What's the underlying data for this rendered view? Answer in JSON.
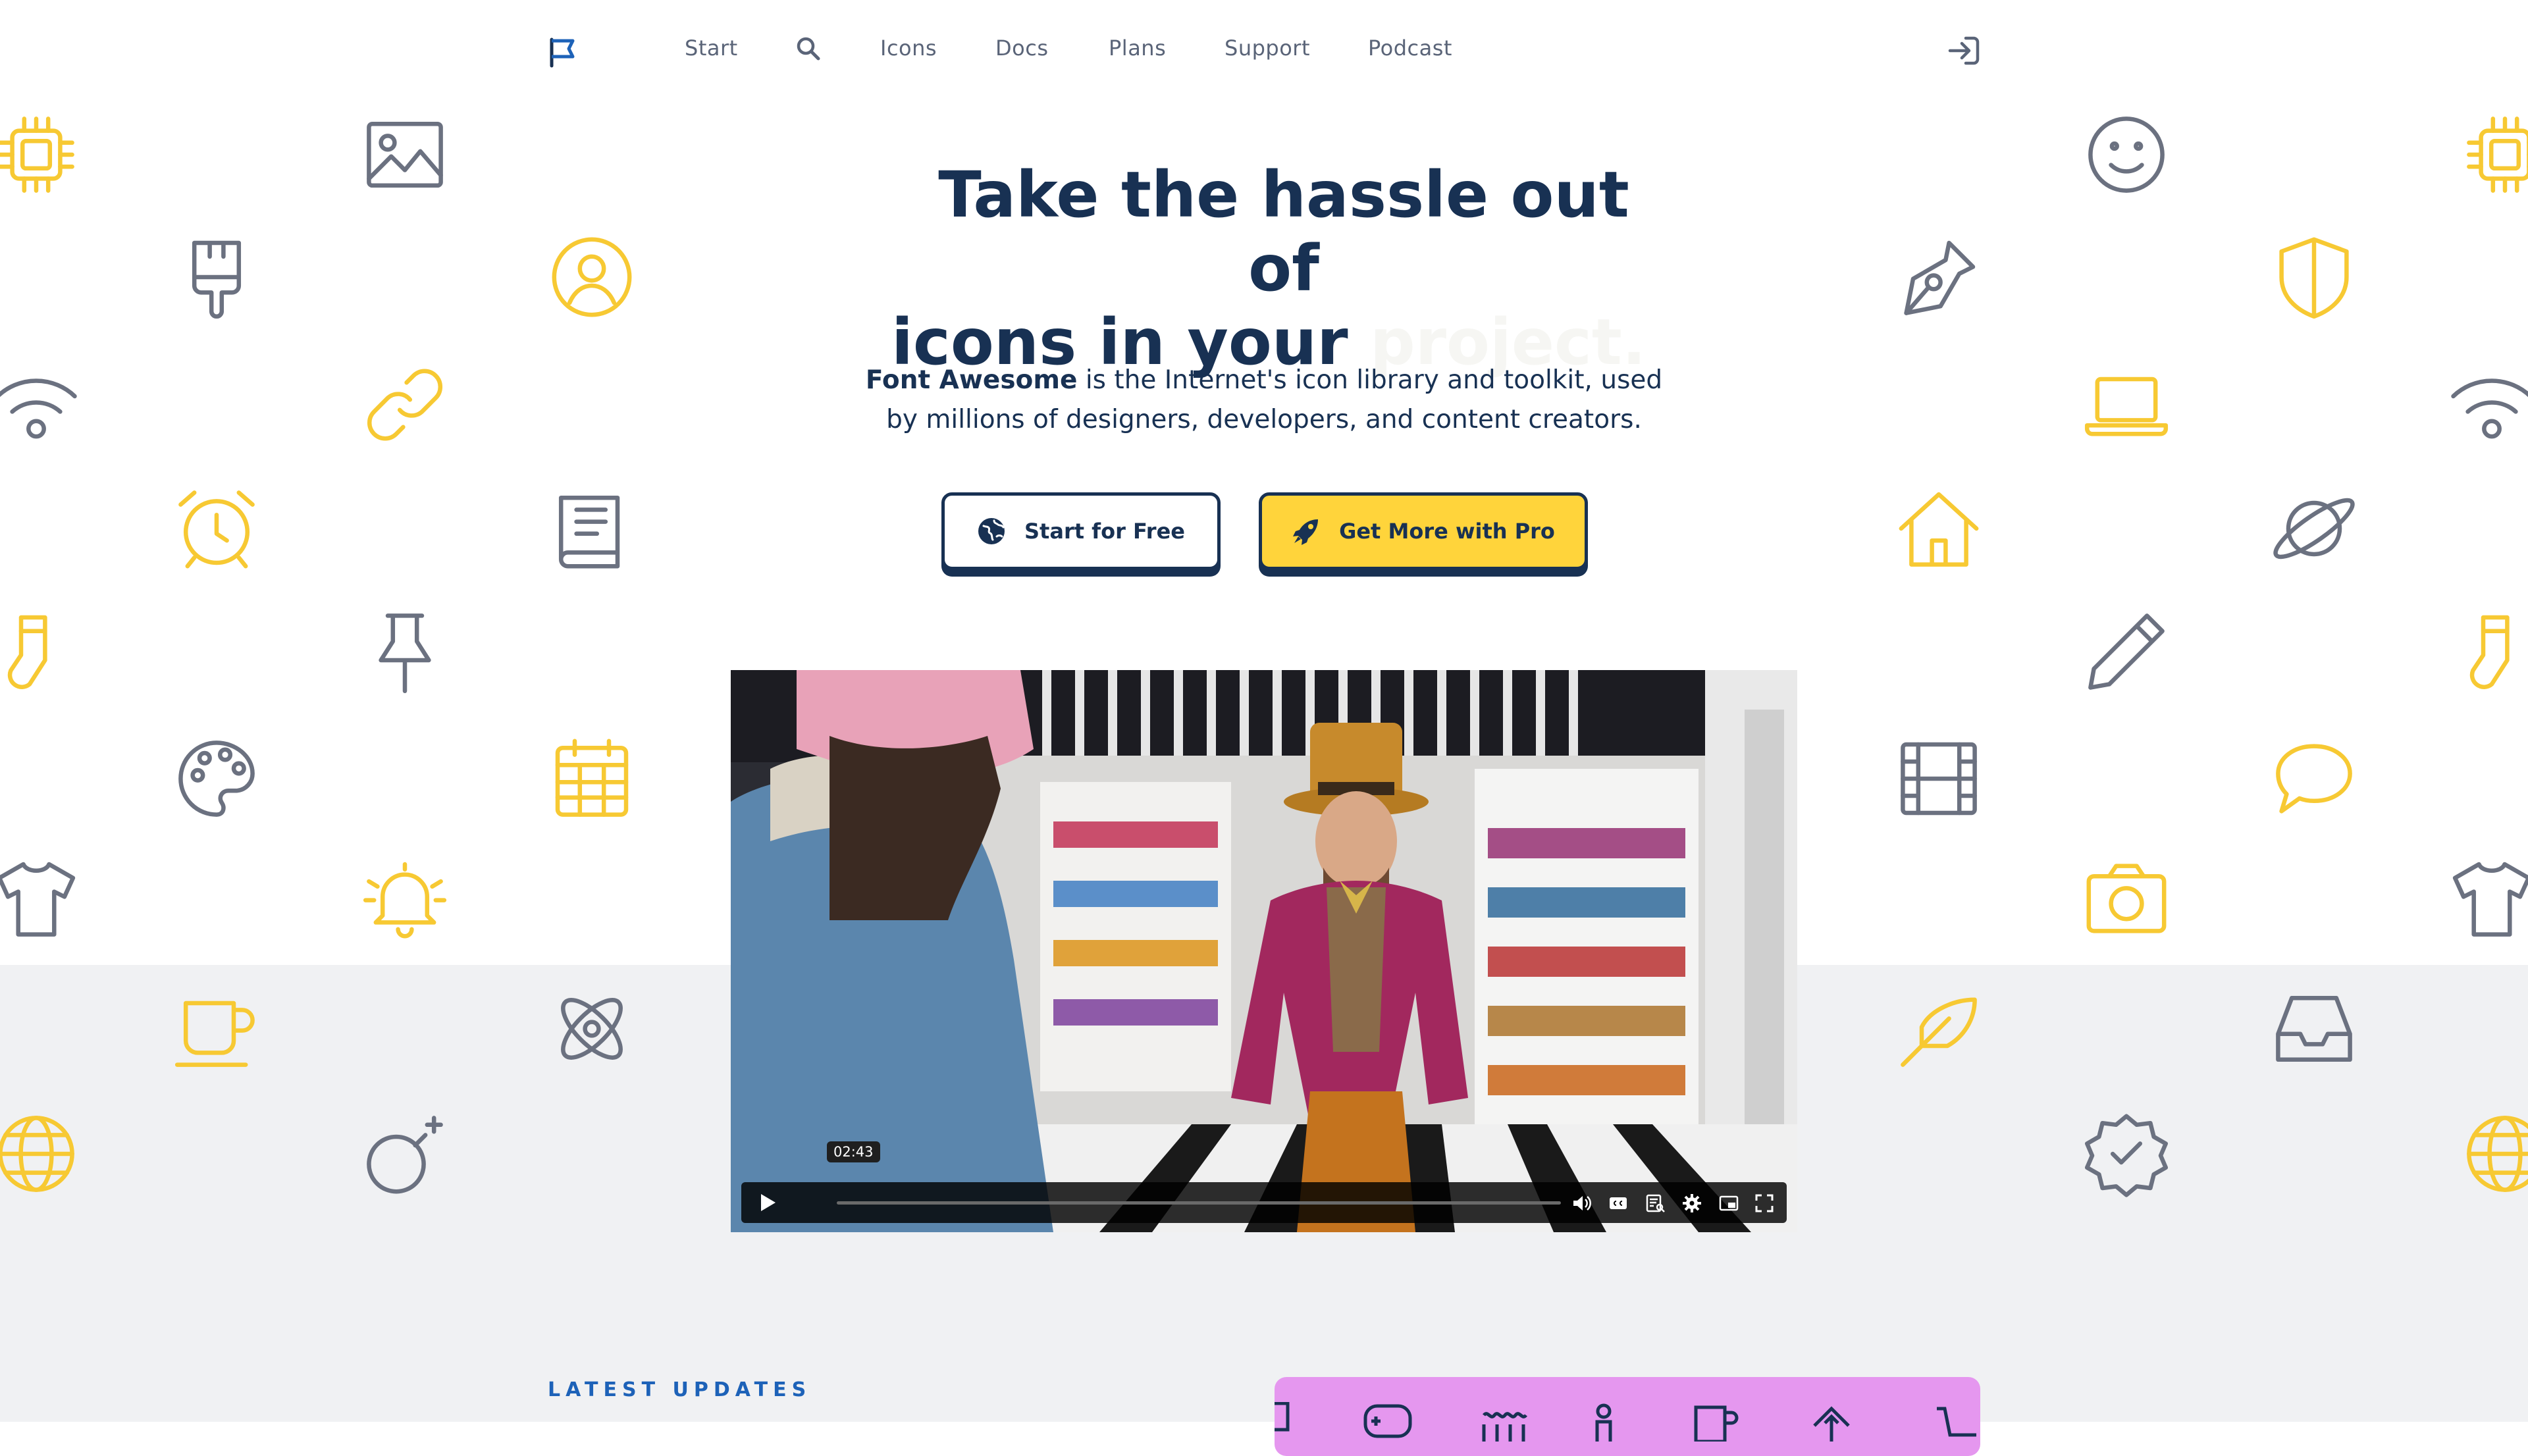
{
  "nav": {
    "logo_icon": "flag-icon",
    "items": [
      {
        "label": "Start"
      },
      {
        "label": "Icons"
      },
      {
        "label": "Docs"
      },
      {
        "label": "Plans"
      },
      {
        "label": "Support"
      },
      {
        "label": "Podcast"
      }
    ],
    "search_icon": "search-icon",
    "signin_icon": "sign-in-icon"
  },
  "hero": {
    "title_line1": "Take the hassle out of",
    "title_line2": "icons in your",
    "title_fade": "project.",
    "subtitle_brand": "Font Awesome",
    "subtitle_rest": " is the Internet's icon library and toolkit, used by millions of designers, developers, and content creators."
  },
  "buttons": {
    "free_label": "Start for Free",
    "free_icon": "globe-icon",
    "pro_label": "Get More with Pro",
    "pro_icon": "rocket-icon"
  },
  "video": {
    "time_tooltip": "02:43",
    "controls": [
      "play-icon",
      "volume-icon",
      "captions-icon",
      "transcript-icon",
      "settings-icon",
      "picture-in-picture-icon",
      "fullscreen-icon"
    ]
  },
  "latest": {
    "heading": "LATEST UPDATES"
  },
  "colors": {
    "navy": "#183153",
    "yellow": "#ffd43b",
    "icon_yellow": "#f7c933",
    "icon_gray": "#6b7180",
    "band_gray": "#f0f1f3",
    "promo_pink": "#e597ef",
    "latest_blue": "#1d62b8"
  }
}
